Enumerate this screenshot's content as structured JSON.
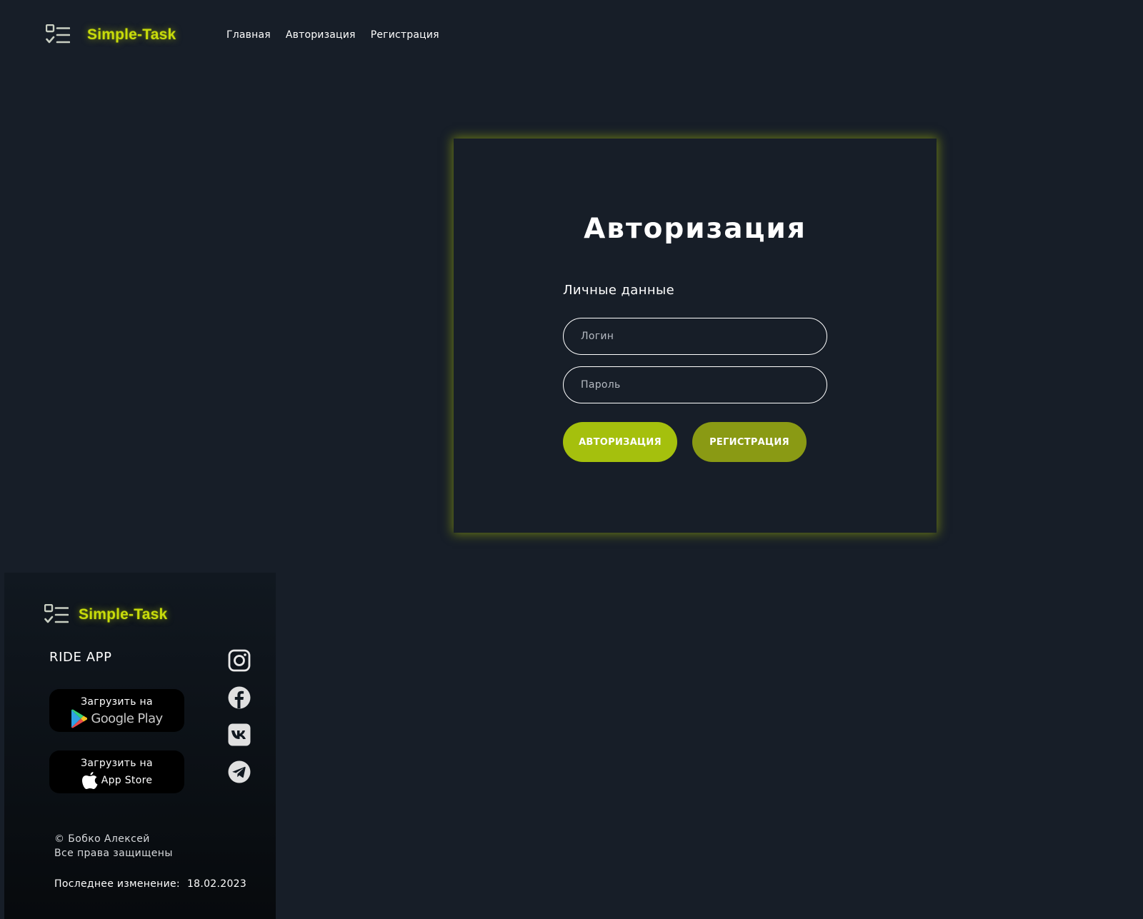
{
  "brand": {
    "name": "Simple-Task",
    "accent": "#c8dc0a",
    "icon": "task-list-icon"
  },
  "nav": {
    "items": [
      {
        "label": "Главная"
      },
      {
        "label": "Авторизация"
      },
      {
        "label": "Регистрация"
      }
    ]
  },
  "auth": {
    "title": "Авторизация",
    "section_label": "Личные данные",
    "login_placeholder": "Логин",
    "password_placeholder": "Пароль",
    "login_button": "АВТОРИЗАЦИЯ",
    "register_button": "РЕГИСТРАЦИЯ",
    "login_button_color": "#a5c00d",
    "register_button_color": "#8a9a14"
  },
  "footer": {
    "brand": "Simple-Task",
    "ride_app": "RIDE APP",
    "google_play": {
      "top": "Загрузить на",
      "name": "Google Play",
      "icon": "google-play-icon"
    },
    "app_store": {
      "top": "Загрузить на",
      "name": "App Store",
      "icon": "apple-icon"
    },
    "social": [
      "instagram-icon",
      "facebook-icon",
      "vk-icon",
      "telegram-icon"
    ],
    "copyright_line1": "© Бобко Алексей",
    "copyright_line2": "Все права защищены",
    "updated_label": "Последнее изменение:",
    "updated_date": "18.02.2023"
  },
  "colors": {
    "background": "#171e28",
    "card_glow": "#aabe0a"
  }
}
